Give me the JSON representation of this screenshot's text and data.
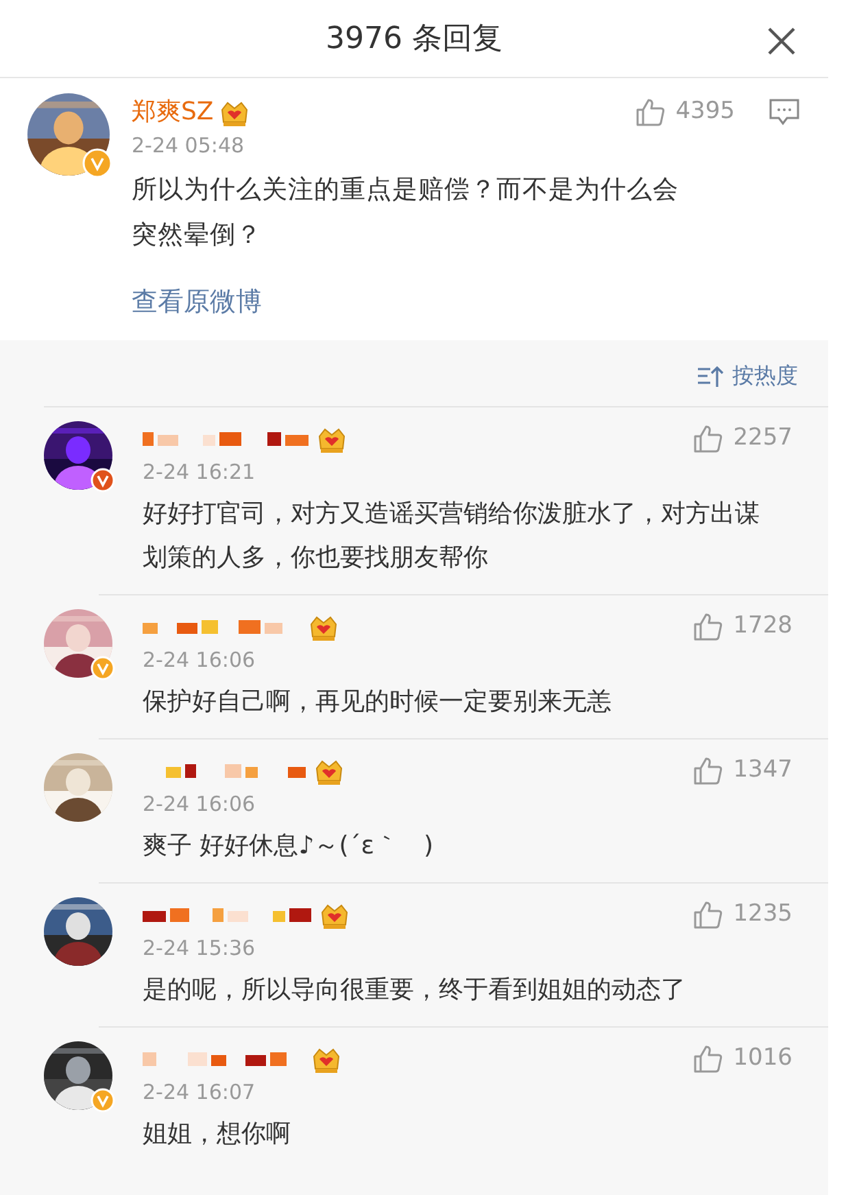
{
  "header": {
    "title": "3976 条回复"
  },
  "post": {
    "author": "郑爽SZ",
    "verified": true,
    "color": "#f5a623",
    "time": "2-24 05:48",
    "likes": "4395",
    "text": "所以为什么关注的重点是赔偿？而不是为什么会突然晕倒？",
    "link": "查看原微博"
  },
  "sort": {
    "label": "按热度"
  },
  "replies": [
    {
      "verified": true,
      "color": "#e0521b",
      "time": "2-24 16:21",
      "likes": "2257",
      "text": "好好打官司，对方又造谣买营销给你泼脏水了，对方出谋划策的人多，你也要找朋友帮你"
    },
    {
      "verified": true,
      "color": "#f5a623",
      "time": "2-24 16:06",
      "likes": "1728",
      "text": "保护好自己啊，再见的时候一定要别来无恙"
    },
    {
      "verified": false,
      "time": "2-24 16:06",
      "likes": "1347",
      "text": "爽子 好好休息♪～(´ε｀　)"
    },
    {
      "verified": false,
      "time": "2-24 15:36",
      "likes": "1235",
      "text": "是的呢，所以导向很重要，终于看到姐姐的动态了"
    },
    {
      "verified": true,
      "color": "#f5a623",
      "time": "2-24 16:07",
      "likes": "1016",
      "text": "姐姐，想你啊"
    }
  ]
}
